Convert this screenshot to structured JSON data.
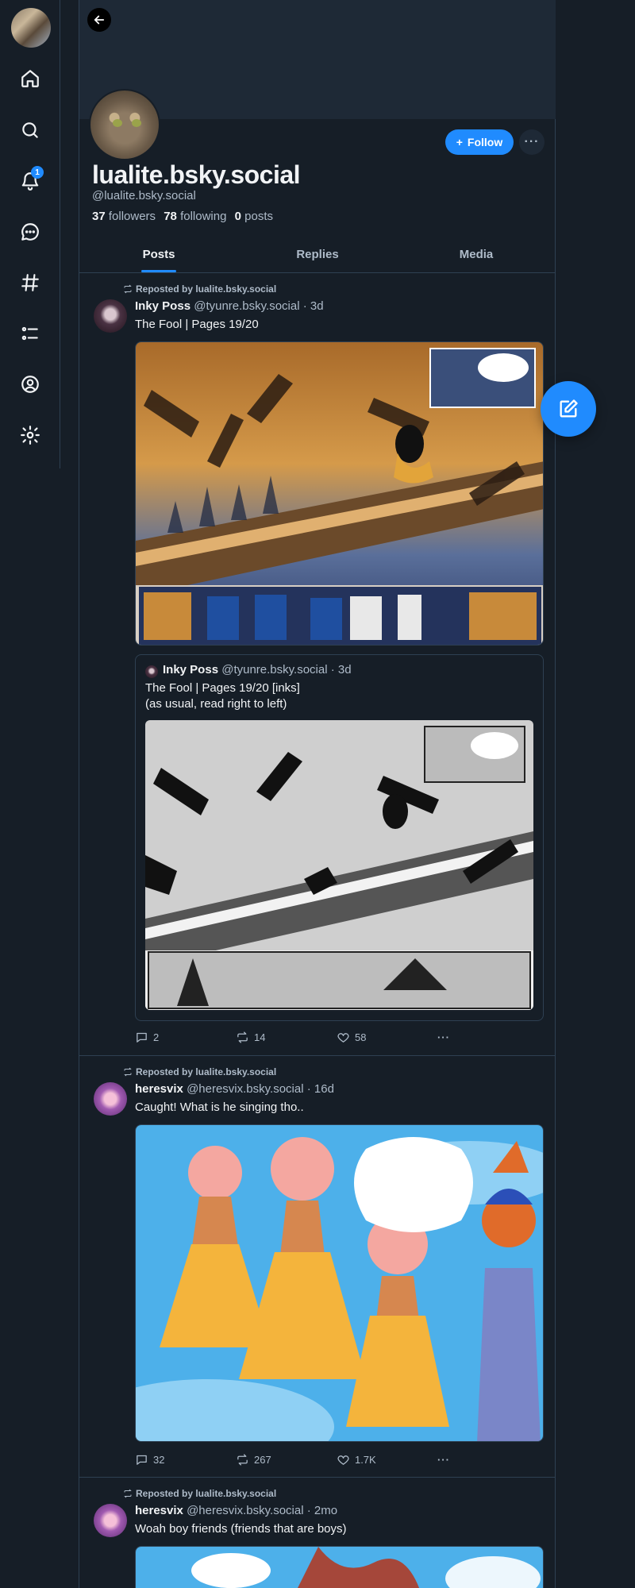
{
  "nav": {
    "notification_count": "1",
    "items": [
      "home-icon",
      "search-icon",
      "bell-icon",
      "chat-icon",
      "hashtag-icon",
      "list-icon",
      "profile-icon",
      "gear-icon"
    ]
  },
  "profile": {
    "display_name": "lualite.bsky.social",
    "handle": "@lualite.bsky.social",
    "followers_count": "37",
    "followers_label": "followers",
    "following_count": "78",
    "following_label": "following",
    "posts_count": "0",
    "posts_label": "posts",
    "follow_label": "Follow",
    "more_label": "···"
  },
  "tabs": [
    {
      "label": "Posts",
      "active": true
    },
    {
      "label": "Replies",
      "active": false
    },
    {
      "label": "Media",
      "active": false
    }
  ],
  "posts": [
    {
      "repost_label": "Reposted by lualite.bsky.social",
      "author": "Inky Poss",
      "handle_time": "@tyunre.bsky.social · 3d",
      "text": "The Fool | Pages 19/20",
      "quote": {
        "author": "Inky Poss",
        "handle_time": "@tyunre.bsky.social · 3d",
        "text_line1": "The Fool | Pages 19/20 [inks]",
        "text_line2": "(as usual, read right to left)"
      },
      "replies": "2",
      "reposts": "14",
      "likes": "58"
    },
    {
      "repost_label": "Reposted by lualite.bsky.social",
      "author": "heresvix",
      "handle_time": "@heresvix.bsky.social · 16d",
      "text": "Caught! What is he singing tho..",
      "replies": "32",
      "reposts": "267",
      "likes": "1.7K"
    },
    {
      "repost_label": "Reposted by lualite.bsky.social",
      "author": "heresvix",
      "handle_time": "@heresvix.bsky.social · 2mo",
      "text": "Woah boy friends (friends that are boys)"
    }
  ],
  "colors": {
    "background": "#161e27",
    "accent": "#208bfe",
    "border": "#2e4052",
    "muted_text": "#aebbc9"
  }
}
